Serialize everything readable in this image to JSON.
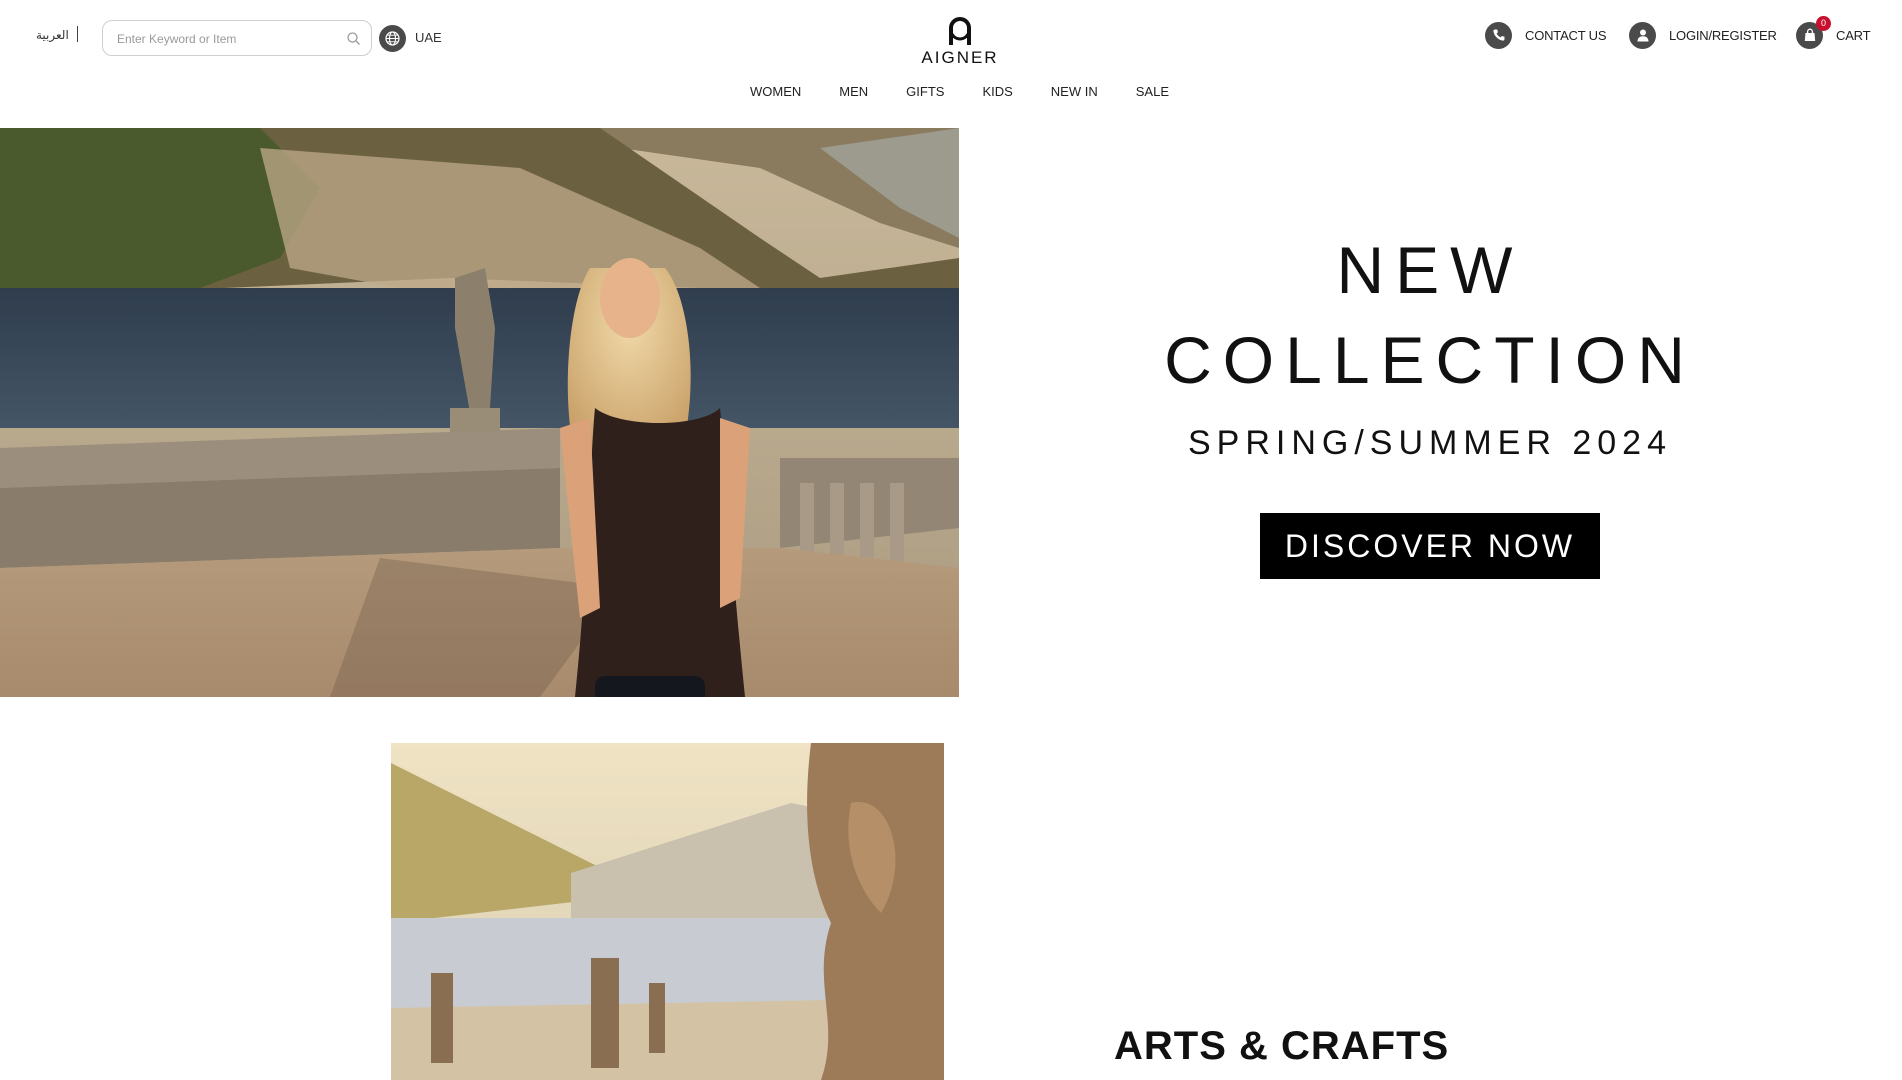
{
  "header": {
    "language_link": "العربية",
    "search": {
      "placeholder": "Enter Keyword or Item",
      "value": ""
    },
    "region": "UAE",
    "logo_text": "AIGNER",
    "contact_label": "CONTACT US",
    "login_label": "LOGIN/REGISTER",
    "cart_label": "CART",
    "cart_count": "0"
  },
  "nav": {
    "items": [
      {
        "label": "WOMEN"
      },
      {
        "label": "MEN"
      },
      {
        "label": "GIFTS"
      },
      {
        "label": "KIDS"
      },
      {
        "label": "NEW IN"
      },
      {
        "label": "SALE"
      }
    ]
  },
  "hero": {
    "title_line1": "NEW",
    "title_line2": "COLLECTION",
    "subtitle": "SPRING/SUMMER 2024",
    "cta_label": "DISCOVER NOW"
  },
  "section2": {
    "title": "ARTS & CRAFTS"
  },
  "colors": {
    "brand_text": "#111111",
    "icon_bg": "#4a4a4a",
    "cart_badge": "#c8102e",
    "cta_bg": "#000000"
  },
  "icons": [
    "search-icon",
    "globe-icon",
    "phone-icon",
    "user-icon",
    "shopping-bag-icon"
  ]
}
